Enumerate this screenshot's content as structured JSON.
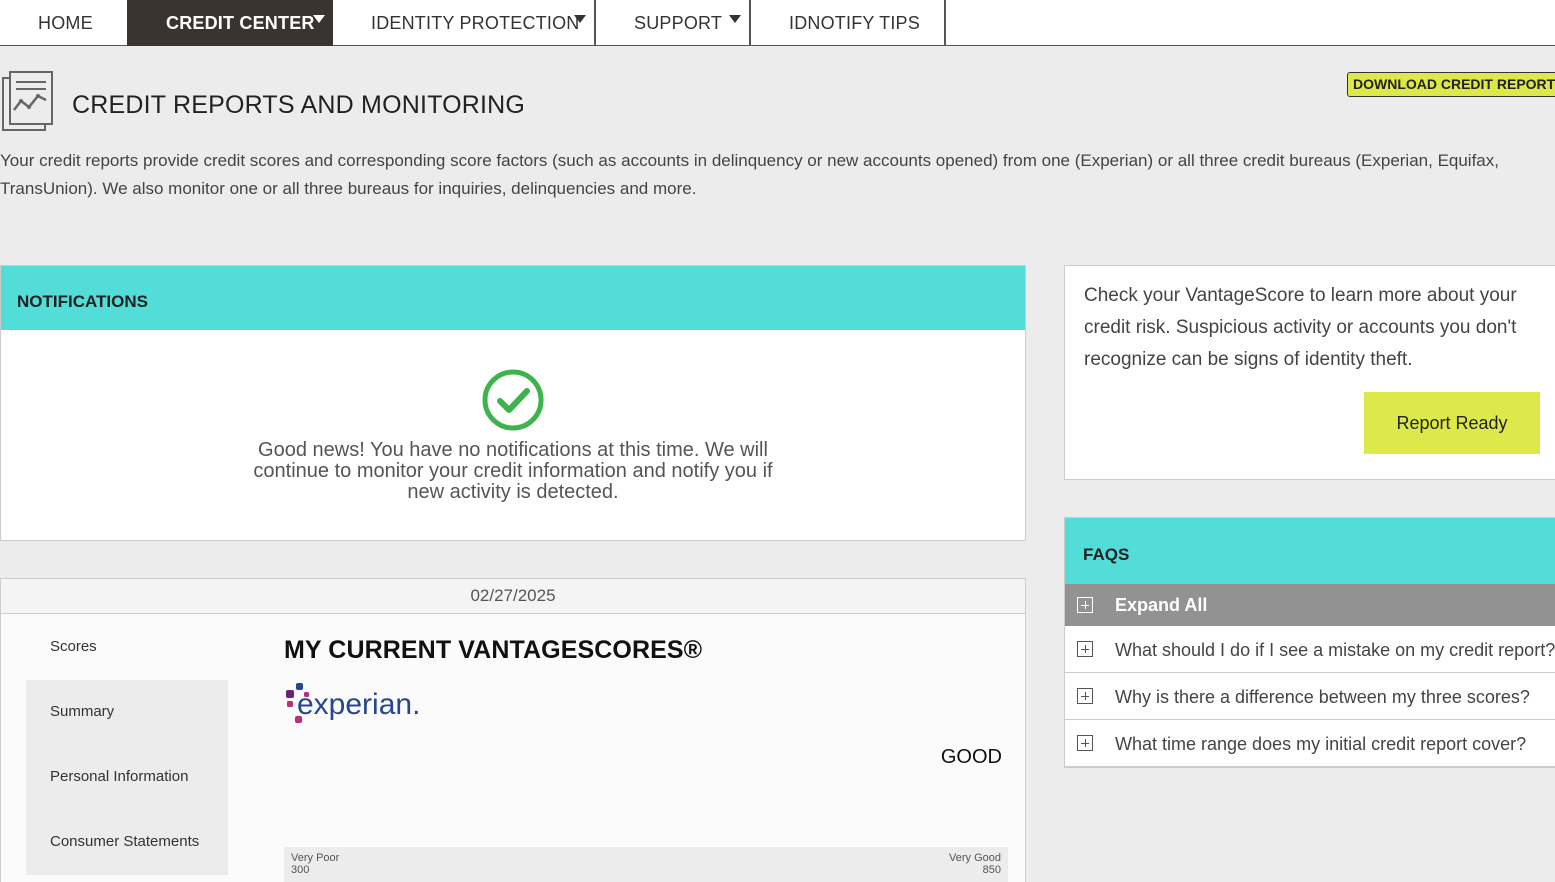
{
  "nav": {
    "home": "HOME",
    "credit_center": "CREDIT CENTER",
    "identity_protection": "IDENTITY PROTECTION",
    "support": "SUPPORT",
    "idnotify_tips": "IDNOTIFY TIPS"
  },
  "header": {
    "title": "CREDIT REPORTS AND MONITORING",
    "download_button": "DOWNLOAD CREDIT REPORTS",
    "description": "Your credit reports provide credit scores and corresponding score factors (such as accounts in delinquency or new accounts opened) from one (Experian) or all three credit bureaus (Experian, Equifax, TransUnion). We also monitor one or all three bureaus for inquiries, delinquencies and more."
  },
  "notifications": {
    "title": "NOTIFICATIONS",
    "message": "Good news! You have no notifications at this time. We will continue to monitor your credit information and notify you if new activity is detected."
  },
  "scores": {
    "date": "02/27/2025",
    "menu": [
      "Scores",
      "Summary",
      "Personal Information",
      "Consumer Statements"
    ],
    "title": "MY CURRENT VANTAGESCORES®",
    "bureau_logo_text": "experian.",
    "rating": "GOOD",
    "range_low_label": "Very Poor",
    "range_low_value": "300",
    "range_high_label": "Very Good",
    "range_high_value": "850"
  },
  "vantage": {
    "text": "Check your VantageScore to learn more about your credit risk. Suspicious activity or accounts you don't recognize can be signs of identity theft.",
    "button": "Report Ready"
  },
  "faqs": {
    "title": "FAQS",
    "expand_all": "Expand All",
    "items": [
      "What should I do if I see a mistake on my credit report?",
      "Why is there a difference between my three scores?",
      "What time range does my initial credit report cover?"
    ]
  },
  "colors": {
    "accent_teal": "#52ddd8",
    "accent_yellow": "#dde84a",
    "nav_active": "#3a3431",
    "success_green": "#3cb44b",
    "experian_blue": "#26478d",
    "experian_purple": "#6d2077",
    "experian_pink": "#ba2f7d"
  }
}
